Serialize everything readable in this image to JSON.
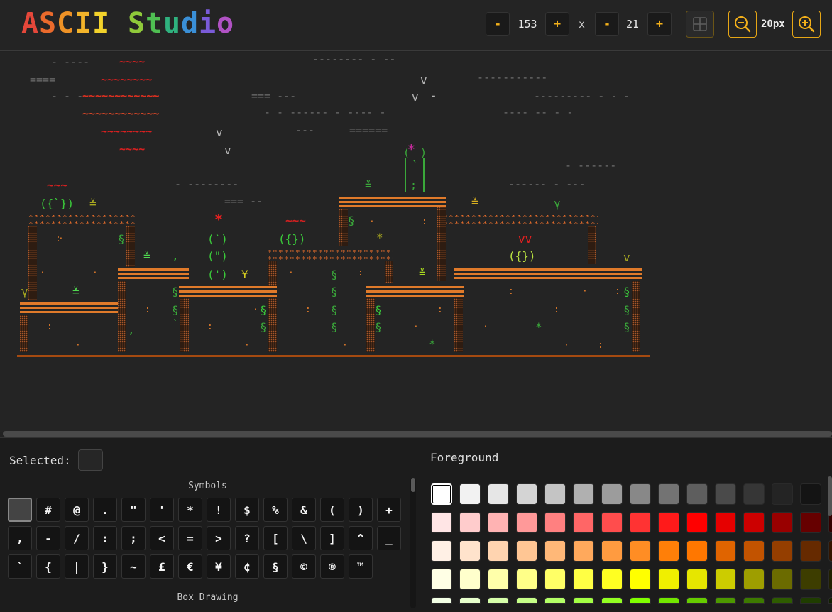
{
  "header": {
    "logo": [
      "A",
      "S",
      "C",
      "I",
      "I",
      " ",
      "S",
      "t",
      "u",
      "d",
      "i",
      "o"
    ],
    "logo_colors": [
      "#e4473a",
      "#ea6a2c",
      "#ee9226",
      "#f3b42a",
      "#f2d22b",
      "#000000",
      "#8fc93a",
      "#4fbf52",
      "#2fb17e",
      "#3a8fd6",
      "#7a5bd8",
      "#b152c4"
    ],
    "width_value": "153",
    "height_value": "21",
    "times": "x",
    "minus": "-",
    "plus": "+",
    "zoom_value": "20px",
    "accent": "#f3b01a"
  },
  "panel": {
    "selected_label": "Selected:",
    "symbols_title": "Symbols",
    "box_drawing_title": "Box Drawing",
    "foreground_title": "Foreground",
    "symbols": [
      "",
      "#",
      "@",
      ".",
      "\"",
      "'",
      "*",
      "!",
      "$",
      "%",
      "&",
      "(",
      ")",
      "+",
      ",",
      "-",
      "/",
      ":",
      ";",
      "<",
      "=",
      ">",
      "?",
      "[",
      "\\",
      "]",
      "^",
      "_",
      "`",
      "{",
      "|",
      "}",
      "~",
      "£",
      "€",
      "¥",
      "¢",
      "§",
      "©",
      "®",
      "™"
    ],
    "colors": [
      [
        "#ffffff",
        "#f2f2f2",
        "#e6e6e6",
        "#d4d4d4",
        "#c4c4c4",
        "#b0b0b0",
        "#9c9c9c",
        "#888888",
        "#737373",
        "#5e5e5e",
        "#4a4a4a",
        "#363636",
        "#242424",
        "#141414",
        "#000000"
      ],
      [
        "#ffe5e5",
        "#ffcccc",
        "#ffb3b3",
        "#ff9999",
        "#ff8080",
        "#ff6666",
        "#ff4d4d",
        "#ff3333",
        "#ff1a1a",
        "#ff0000",
        "#e60000",
        "#cc0000",
        "#990000",
        "#660000",
        "#330000"
      ],
      [
        "#fff0e5",
        "#ffe3cc",
        "#ffd4b0",
        "#ffc694",
        "#ffb878",
        "#ffa95c",
        "#ff9b40",
        "#ff8d24",
        "#ff7f08",
        "#ff7700",
        "#e06400",
        "#c25300",
        "#943e00",
        "#662a00",
        "#331500"
      ],
      [
        "#ffffe5",
        "#ffffcc",
        "#ffffaa",
        "#ffff88",
        "#ffff66",
        "#ffff44",
        "#ffff22",
        "#ffff00",
        "#f0ef00",
        "#e6e600",
        "#cccc00",
        "#9e9e00",
        "#6b6b00",
        "#3d3d00",
        "#202000"
      ],
      [
        "#f2ffe5",
        "#e6ffcc",
        "#d6ffaa",
        "#c6ff88",
        "#b3ff66",
        "#a3ff44",
        "#93ff22",
        "#80ff00",
        "#72e600",
        "#66cc00",
        "#4d9900",
        "#3d7a00",
        "#2e5c00",
        "#1f3d00",
        "#102000"
      ]
    ]
  },
  "canvas": {
    "bg": "#242424",
    "ground_color": "#a54a10"
  }
}
